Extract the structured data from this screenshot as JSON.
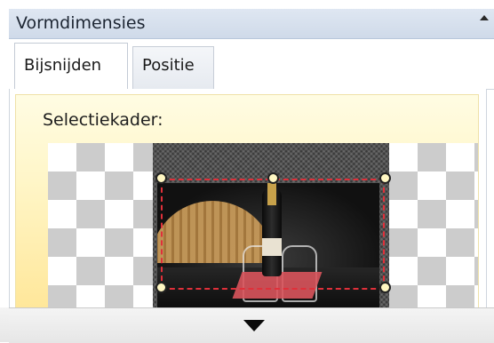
{
  "pane": {
    "title": "Vormdimensies",
    "collapse_icon": "triangle-up-icon"
  },
  "tabs": [
    {
      "label": "Bijsnijden",
      "active": true
    },
    {
      "label": "Positie",
      "active": false
    }
  ],
  "crop": {
    "section_label": "Selectiekader:",
    "image_description_icon": "photo-preview"
  },
  "scroll": {
    "down_icon": "triangle-down-icon"
  },
  "colors": {
    "crop_frame": "#e0303a",
    "panel_gradient_top": "#fffce3",
    "panel_gradient_bottom": "#ffe79a",
    "titlebar": "#d4deec"
  }
}
